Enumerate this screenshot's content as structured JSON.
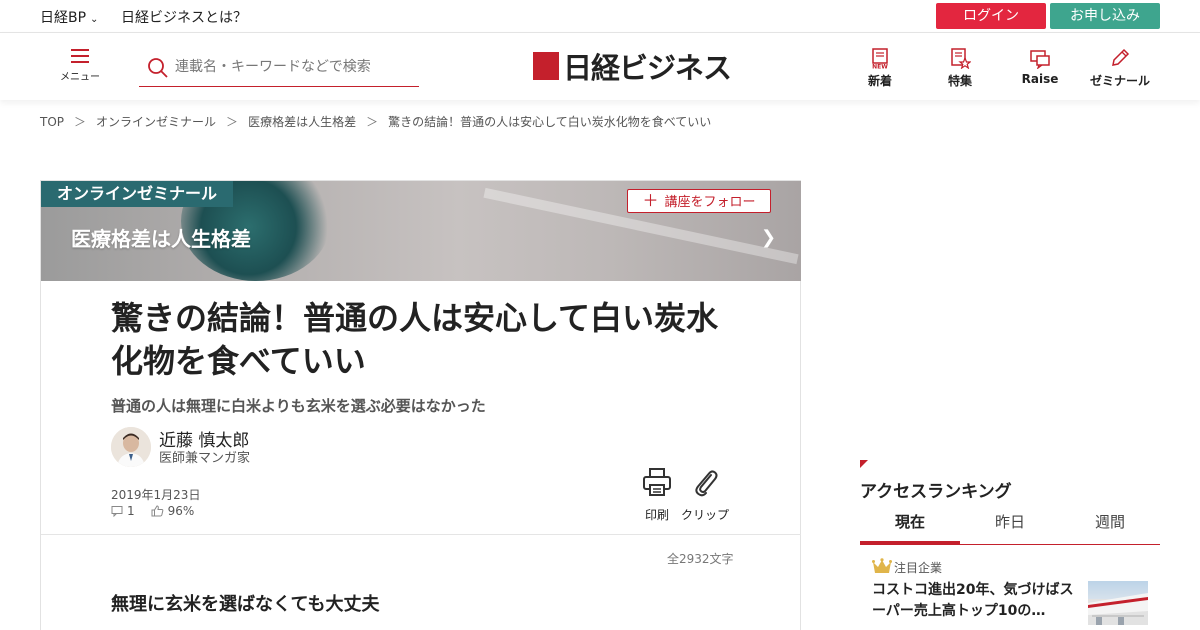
{
  "topbar": {
    "nikkei_bp": "日経BP",
    "about": "日経ビジネスとは？",
    "login": "ログイン",
    "apply": "お申し込み"
  },
  "header": {
    "menu_label": "メニュー",
    "search_placeholder": "連載名・キーワードなどで検索",
    "logo_text": "日経ビジネス",
    "nav": [
      {
        "label": "新着",
        "icon": "new-doc-icon"
      },
      {
        "label": "特集",
        "icon": "feature-star-icon"
      },
      {
        "label": "Raise",
        "icon": "chat-bubble-icon"
      },
      {
        "label": "ゼミナール",
        "icon": "pencil-icon"
      }
    ]
  },
  "breadcrumb": {
    "items": [
      "TOP",
      "オンラインゼミナール",
      "医療格差は人生格差",
      "驚きの結論！普通の人は安心して白い炭水化物を食べていい"
    ],
    "separator": "＞"
  },
  "banner": {
    "tag": "オンラインゼミナール",
    "series_title": "医療格差は人生格差",
    "follow_label": "講座をフォロー"
  },
  "article": {
    "title": "驚きの結論！普通の人は安心して白い炭水化物を食べていい",
    "subtitle": "普通の人は無理に白米よりも玄米を選ぶ必要はなかった",
    "author_name": "近藤 慎太郎",
    "author_role": "医師兼マンガ家",
    "date": "2019年1月23日",
    "comment_count": "1",
    "like_percent": "96%",
    "print_label": "印刷",
    "clip_label": "クリップ",
    "char_count": "全2932文字",
    "section_heading": "無理に玄米を選ばなくても大丈夫"
  },
  "ranking": {
    "title": "アクセスランキング",
    "tabs": [
      "現在",
      "昨日",
      "週間"
    ],
    "active_tab": "現在",
    "item_badge": "注目企業",
    "item_text": "コストコ進出20年、気づけばスーパー売上高トップ10の…"
  },
  "colors": {
    "accent_red": "#c4202c",
    "login_red": "#e3263f",
    "apply_green": "#3ea58e",
    "series_tag": "#2a6a70"
  }
}
